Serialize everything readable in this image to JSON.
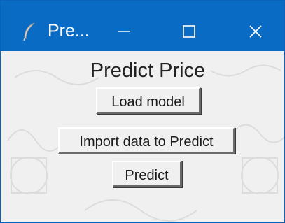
{
  "window": {
    "title": "Pre...",
    "app_icon": "feather-icon",
    "controls": {
      "minimize_icon": "minimize-icon",
      "maximize_icon": "maximize-icon",
      "close_icon": "close-icon"
    }
  },
  "main": {
    "heading": "Predict Price",
    "load_model_label": "Load model",
    "import_data_label": "Import data to Predict",
    "predict_label": "Predict"
  },
  "colors": {
    "titlebar": "#0a6bc4",
    "window_bg": "#f0f0f0",
    "text": "#1a1a1a"
  }
}
